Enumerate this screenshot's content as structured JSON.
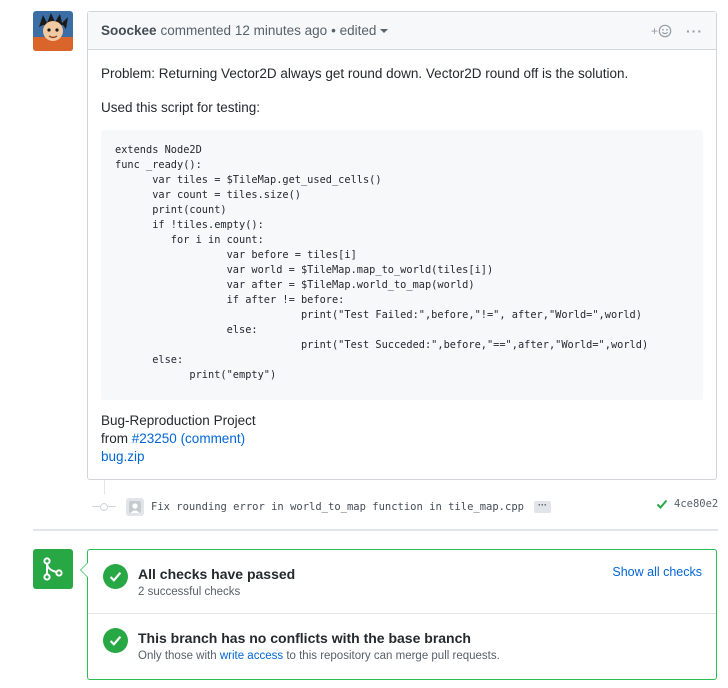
{
  "comment": {
    "author": "Soockee",
    "action_text": "commented 12 minutes ago",
    "edited_text": "• edited",
    "reaction_label": "+",
    "more_label": "···",
    "paragraph1": "Problem: Returning Vector2D always get round down. Vector2D round off is the solution.",
    "paragraph2": "Used this script for testing:",
    "code": "extends Node2D\nfunc _ready():\n\tvar tiles = $TileMap.get_used_cells()\n\tvar count = tiles.size()\n\tprint(count)\n\tif !tiles.empty():\n\t   for i in count:\n\t\t\tvar before = tiles[i]\n\t\t\tvar world = $TileMap.map_to_world(tiles[i])\n\t\t\tvar after = $TileMap.world_to_map(world)\n\t\t\tif after != before:\n\t\t\t\t\tprint(\"Test Failed:\",before,\"!=\", after,\"World=\",world)\n\t\t\telse:\n\t\t\t\t\tprint(\"Test Succeded:\",before,\"==\",after,\"World=\",world)\n\telse:\n\t\tprint(\"empty\")",
    "bug_title": "Bug-Reproduction Project",
    "from_text": "from",
    "from_link": "#23250 (comment)",
    "file_link": "bug.zip"
  },
  "commit": {
    "message": "Fix rounding error in world_to_map function in tile_map.cpp",
    "ellipsis": "···",
    "sha": "4ce80e2"
  },
  "merge": {
    "checks_title": "All checks have passed",
    "checks_sub": "2 successful checks",
    "show_checks": "Show all checks",
    "conflict_title": "This branch has no conflicts with the base branch",
    "conflict_sub_pre": "Only those with",
    "conflict_sub_link": "write access",
    "conflict_sub_post": "to this repository can merge pull requests."
  },
  "colors": {
    "success": "#28a745",
    "link": "#0366d6",
    "border": "#d1d5da"
  }
}
